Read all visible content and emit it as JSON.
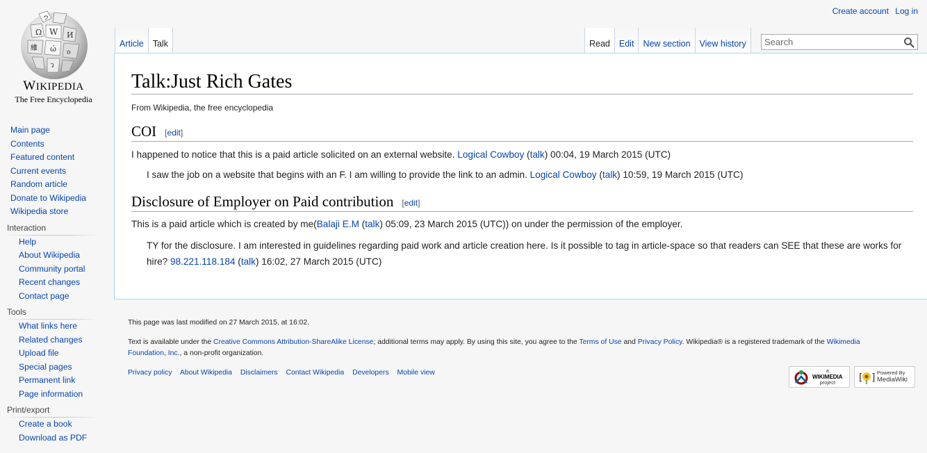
{
  "logo": {
    "wordmark_w": "W",
    "wordmark_rest": "IKIPEDIA",
    "tagline": "The Free Encyclopedia"
  },
  "navigation": {
    "main": [
      "Main page",
      "Contents",
      "Featured content",
      "Current events",
      "Random article",
      "Donate to Wikipedia",
      "Wikipedia store"
    ],
    "interaction": {
      "heading": "Interaction",
      "items": [
        "Help",
        "About Wikipedia",
        "Community portal",
        "Recent changes",
        "Contact page"
      ]
    },
    "tools": {
      "heading": "Tools",
      "items": [
        "What links here",
        "Related changes",
        "Upload file",
        "Special pages",
        "Permanent link",
        "Page information"
      ]
    },
    "print": {
      "heading": "Print/export",
      "items": [
        "Create a book",
        "Download as PDF"
      ]
    }
  },
  "personal": {
    "create_account": "Create account",
    "login": "Log in"
  },
  "tabs": {
    "article": "Article",
    "talk": "Talk",
    "read": "Read",
    "edit": "Edit",
    "new_section": "New section",
    "view_history": "View history"
  },
  "search": {
    "placeholder": "Search"
  },
  "page": {
    "title": "Talk:Just Rich Gates",
    "site_sub": "From Wikipedia, the free encyclopedia"
  },
  "sections": [
    {
      "heading": "COI",
      "edit": "edit",
      "comments": [
        {
          "text": "I happened to notice that this is a paid article solicited on an external website. ",
          "user": "Logical Cowboy",
          "talk_open": " (",
          "talk": "talk",
          "talk_close": ") ",
          "timestamp": "00:04, 19 March 2015 (UTC)"
        },
        {
          "text": "I saw the job on a website that begins with an F. I am willing to provide the link to an admin. ",
          "user": "Logical Cowboy",
          "talk_open": " (",
          "talk": "talk",
          "talk_close": ") ",
          "timestamp": "10:59, 19 March 2015 (UTC)"
        }
      ]
    },
    {
      "heading": "Disclosure of Employer on Paid contribution",
      "edit": "edit",
      "comments": [
        {
          "text": "This is a paid article which is created by me(",
          "user": "Balaji E.M",
          "talk_open": " (",
          "talk": "talk",
          "talk_close": ") ",
          "timestamp": "05:09, 23 March 2015 (UTC))",
          "tail": " on under the permission of the employer."
        },
        {
          "text": "TY for the disclosure. I am interested in guidelines regarding paid work and article creation here. Is it possible to tag in article-space so that readers can SEE that these are works for hire? ",
          "user": "98.221.118.184",
          "talk_open": " (",
          "talk": "talk",
          "talk_close": ") ",
          "timestamp": "16:02, 27 March 2015 (UTC)"
        }
      ]
    }
  ],
  "footer": {
    "last_modified": "This page was last modified on 27 March 2015, at 16:02.",
    "lic_1": "Text is available under the ",
    "lic_link": "Creative Commons Attribution-ShareAlike License",
    "lic_2": "; additional terms may apply. By using this site, you agree to the ",
    "terms": "Terms of Use",
    "and": " and ",
    "privacy": "Privacy Policy",
    "lic_3": ". Wikipedia® is a registered trademark of the ",
    "wmf": "Wikimedia Foundation, Inc.",
    "lic_4": ", a non-profit organization.",
    "places": [
      "Privacy policy",
      "About Wikipedia",
      "Disclaimers",
      "Contact Wikipedia",
      "Developers",
      "Mobile view"
    ],
    "wm_badge": {
      "a": "a",
      "name": "WIKIMEDIA",
      "project": "project"
    },
    "mw_badge": {
      "powered": "Powered By",
      "name": "MediaWiki"
    }
  },
  "colors": {
    "link": "#0645ad",
    "border": "#a7d7f9",
    "background": "#f6f6f6"
  }
}
